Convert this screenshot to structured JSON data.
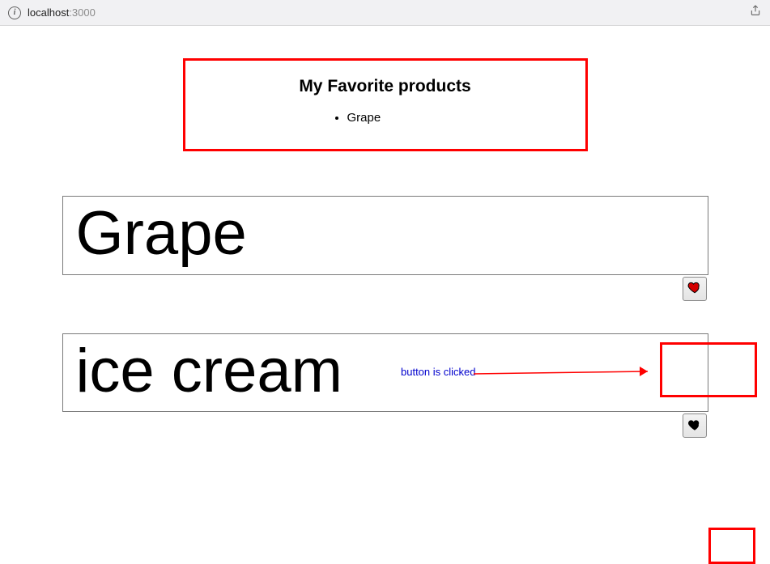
{
  "browser": {
    "url_host": "localhost",
    "url_port": ":3000"
  },
  "favorites": {
    "title": "My Favorite products",
    "items": [
      "Grape"
    ]
  },
  "products": [
    {
      "name": "Grape",
      "favorited": true
    },
    {
      "name": "ice cream",
      "favorited": false
    }
  ],
  "annotations": {
    "click_label": "button is clicked"
  },
  "colors": {
    "annotation_red": "#ff0000",
    "annotation_blue": "#0000cd",
    "heart_red": "#d40000"
  }
}
